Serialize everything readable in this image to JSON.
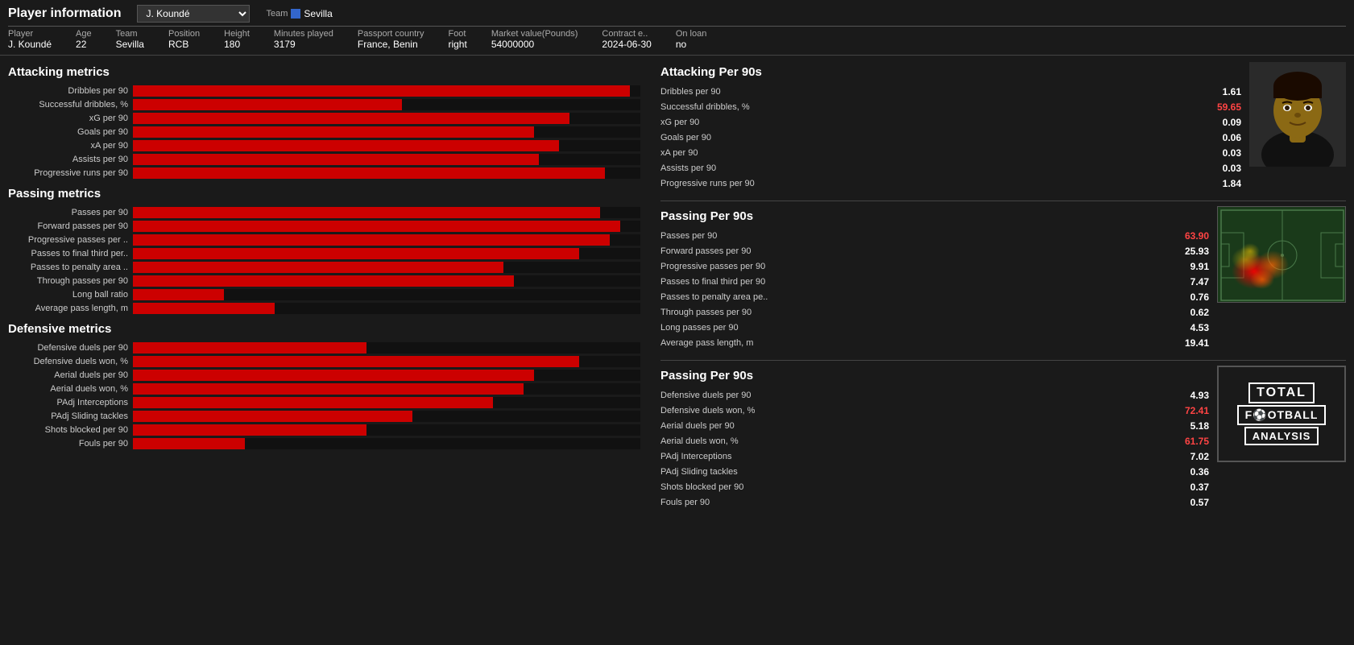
{
  "header": {
    "title": "Player information",
    "team_label": "Team",
    "player_select": "J. Koundé",
    "team_name": "Sevilla",
    "columns": [
      "Player",
      "Age",
      "Team",
      "Position",
      "Height",
      "Minutes played",
      "Passport country",
      "Foot",
      "Market value(Pounds)",
      "Contract e..",
      "On loan"
    ],
    "player": {
      "name": "J. Koundé",
      "age": "22",
      "team": "Sevilla",
      "position": "RCB",
      "height": "180",
      "minutes_played": "3179",
      "passport_country": "France, Benin",
      "foot": "right",
      "market_value": "54000000",
      "contract_end": "2024-06-30",
      "on_loan": "no"
    }
  },
  "attacking_metrics": {
    "title": "Attacking metrics",
    "bars": [
      {
        "label": "Dribbles per 90",
        "pct": 98
      },
      {
        "label": "Successful dribbles, %",
        "pct": 53
      },
      {
        "label": "xG per 90",
        "pct": 86
      },
      {
        "label": "Goals per 90",
        "pct": 79
      },
      {
        "label": "xA per 90",
        "pct": 84
      },
      {
        "label": "Assists per 90",
        "pct": 80
      },
      {
        "label": "Progressive runs per 90",
        "pct": 93
      }
    ]
  },
  "attacking_per90": {
    "title": "Attacking Per 90s",
    "metrics": [
      {
        "label": "Dribbles per 90",
        "value": "1.61",
        "highlight": false
      },
      {
        "label": "Successful dribbles, %",
        "value": "59.65",
        "highlight": true
      },
      {
        "label": "xG per 90",
        "value": "0.09",
        "highlight": false
      },
      {
        "label": "Goals per 90",
        "value": "0.06",
        "highlight": false
      },
      {
        "label": "xA per 90",
        "value": "0.03",
        "highlight": false
      },
      {
        "label": "Assists per 90",
        "value": "0.03",
        "highlight": false
      },
      {
        "label": "Progressive runs per 90",
        "value": "1.84",
        "highlight": false
      }
    ]
  },
  "passing_metrics": {
    "title": "Passing metrics",
    "bars": [
      {
        "label": "Passes per 90",
        "pct": 92
      },
      {
        "label": "Forward passes per 90",
        "pct": 96
      },
      {
        "label": "Progressive passes per ..",
        "pct": 94
      },
      {
        "label": "Passes to final third per..",
        "pct": 88
      },
      {
        "label": "Passes to penalty area ..",
        "pct": 73
      },
      {
        "label": "Through passes per 90",
        "pct": 75
      },
      {
        "label": "Long ball ratio",
        "pct": 18
      },
      {
        "label": "Average pass length, m",
        "pct": 28
      }
    ]
  },
  "passing_per90": {
    "title": "Passing Per 90s",
    "metrics": [
      {
        "label": "Passes per 90",
        "value": "63.90",
        "highlight": true
      },
      {
        "label": "Forward passes per 90",
        "value": "25.93",
        "highlight": false
      },
      {
        "label": "Progressive passes per 90",
        "value": "9.91",
        "highlight": false
      },
      {
        "label": "Passes to final third per 90",
        "value": "7.47",
        "highlight": false
      },
      {
        "label": "Passes to penalty area pe..",
        "value": "0.76",
        "highlight": false
      },
      {
        "label": "Through passes per 90",
        "value": "0.62",
        "highlight": false
      },
      {
        "label": "Long passes per 90",
        "value": "4.53",
        "highlight": false
      },
      {
        "label": "Average pass length, m",
        "value": "19.41",
        "highlight": false
      }
    ]
  },
  "defensive_metrics": {
    "title": "Defensive metrics",
    "bars": [
      {
        "label": "Defensive duels per 90",
        "pct": 46
      },
      {
        "label": "Defensive duels won, %",
        "pct": 88
      },
      {
        "label": "Aerial duels per 90",
        "pct": 79
      },
      {
        "label": "Aerial duels won, %",
        "pct": 77
      },
      {
        "label": "PAdj Interceptions",
        "pct": 71
      },
      {
        "label": "PAdj Sliding tackles",
        "pct": 55
      },
      {
        "label": "Shots blocked per 90",
        "pct": 46
      },
      {
        "label": "Fouls per 90",
        "pct": 22
      }
    ]
  },
  "defensive_per90": {
    "title": "Passing Per 90s",
    "metrics": [
      {
        "label": "Defensive duels per 90",
        "value": "4.93",
        "highlight": false
      },
      {
        "label": "Defensive duels won, %",
        "value": "72.41",
        "highlight": true
      },
      {
        "label": "Aerial duels per 90",
        "value": "5.18",
        "highlight": false
      },
      {
        "label": "Aerial duels won, %",
        "value": "61.75",
        "highlight": true
      },
      {
        "label": "PAdj Interceptions",
        "value": "7.02",
        "highlight": false
      },
      {
        "label": "PAdj Sliding tackles",
        "value": "0.36",
        "highlight": false
      },
      {
        "label": "Shots blocked per 90",
        "value": "0.37",
        "highlight": false
      },
      {
        "label": "Fouls per 90",
        "value": "0.57",
        "highlight": false
      }
    ]
  }
}
